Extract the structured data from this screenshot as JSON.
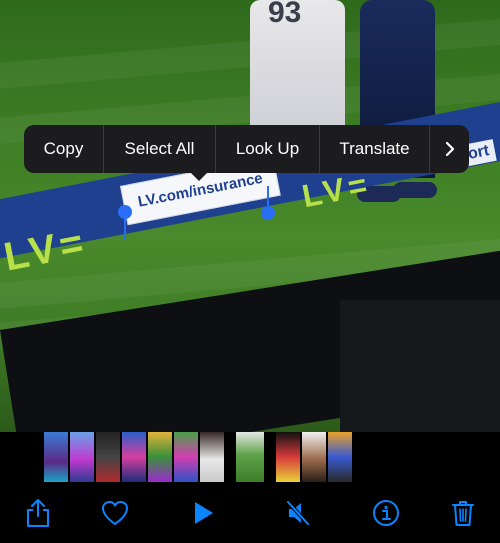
{
  "photo": {
    "jersey_number": "93",
    "board_logo": "LV=",
    "board_text": "LV.com/insurance",
    "board_text_partial": "ort"
  },
  "context_menu": {
    "items": [
      "Copy",
      "Select All",
      "Look Up",
      "Translate"
    ],
    "more_icon": "chevron-right-icon"
  },
  "thumbnails": {
    "count": 12,
    "selected_index": 7
  },
  "toolbar": {
    "icons": [
      "share-icon",
      "heart-icon",
      "play-icon",
      "speaker-muted-icon",
      "info-icon",
      "trash-icon"
    ],
    "accent_color": "#0a84ff"
  }
}
